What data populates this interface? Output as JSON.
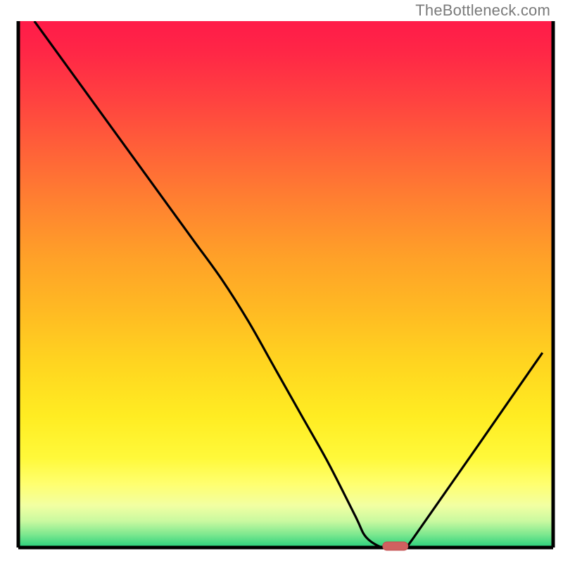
{
  "attribution": "TheBottleneck.com",
  "chart_data": {
    "type": "line",
    "title": "",
    "xlabel": "",
    "ylabel": "",
    "xlim": [
      0,
      100
    ],
    "ylim": [
      0,
      100
    ],
    "x": [
      3,
      23,
      28,
      33,
      38,
      43,
      48,
      53,
      58,
      63,
      65,
      68,
      70,
      72,
      74,
      98
    ],
    "y": [
      100,
      72,
      65,
      58,
      51,
      43,
      34,
      25,
      16,
      6,
      2,
      0,
      0,
      0,
      2,
      37
    ],
    "marker": {
      "x": 70.5,
      "y": 0
    },
    "gradient_stops": [
      {
        "offset": 0.0,
        "color": "#ff1b49"
      },
      {
        "offset": 0.06,
        "color": "#ff2746"
      },
      {
        "offset": 0.15,
        "color": "#ff4240"
      },
      {
        "offset": 0.25,
        "color": "#ff6338"
      },
      {
        "offset": 0.35,
        "color": "#ff8330"
      },
      {
        "offset": 0.45,
        "color": "#ffa128"
      },
      {
        "offset": 0.55,
        "color": "#ffba23"
      },
      {
        "offset": 0.65,
        "color": "#ffd520"
      },
      {
        "offset": 0.75,
        "color": "#ffec22"
      },
      {
        "offset": 0.83,
        "color": "#fff93a"
      },
      {
        "offset": 0.88,
        "color": "#ffff70"
      },
      {
        "offset": 0.92,
        "color": "#f2ffa2"
      },
      {
        "offset": 0.95,
        "color": "#c9f9a0"
      },
      {
        "offset": 0.975,
        "color": "#7ee88f"
      },
      {
        "offset": 1.0,
        "color": "#26d07c"
      }
    ],
    "colors": {
      "axis": "#000000",
      "curve": "#000000",
      "marker_fill": "#d06060",
      "marker_stroke": "#c24f50"
    }
  }
}
